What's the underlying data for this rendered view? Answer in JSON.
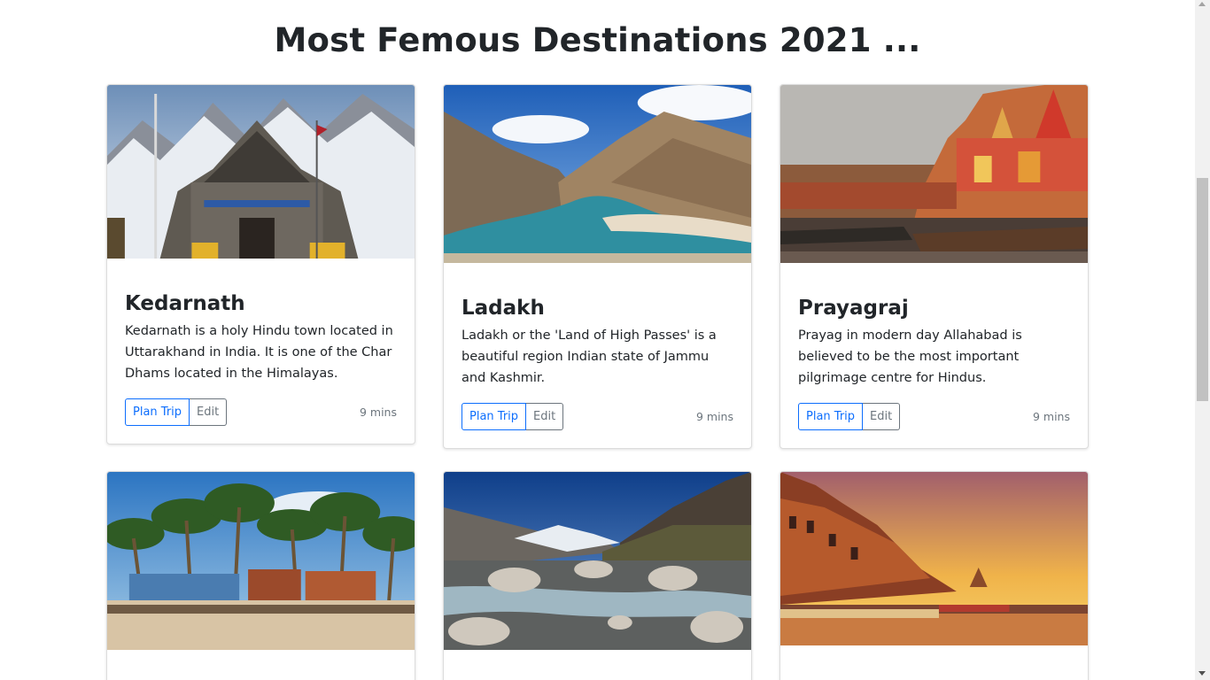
{
  "page": {
    "heading": "Most Femous Destinations 2021 ..."
  },
  "cards": [
    {
      "title": "Kedarnath",
      "text": "Kedarnath is a holy Hindu town located in Uttarakhand in India. It is one of the Char Dhams located in the Himalayas.",
      "plan_label": "Plan Trip",
      "edit_label": "Edit",
      "meta": "9 mins",
      "image": "kedarnath-temple-photo"
    },
    {
      "title": "Ladakh",
      "text": "Ladakh or the 'Land of High Passes' is a beautiful region Indian state of Jammu and Kashmir.",
      "plan_label": "Plan Trip",
      "edit_label": "Edit",
      "meta": "9 mins",
      "image": "ladakh-river-valley-photo"
    },
    {
      "title": "Prayagraj",
      "text": "Prayag in modern day Allahabad is believed to be the most important pilgrimage centre for Hindus.",
      "plan_label": "Plan Trip",
      "edit_label": "Edit",
      "meta": "9 mins",
      "image": "prayagraj-ghats-photo"
    },
    {
      "image": "goa-beach-palms-photo"
    },
    {
      "image": "manali-mountain-river-photo"
    },
    {
      "image": "varanasi-sunset-ghats-photo"
    }
  ],
  "colors": {
    "primary": "#0d6efd",
    "secondary": "#6c757d",
    "text": "#212529"
  }
}
